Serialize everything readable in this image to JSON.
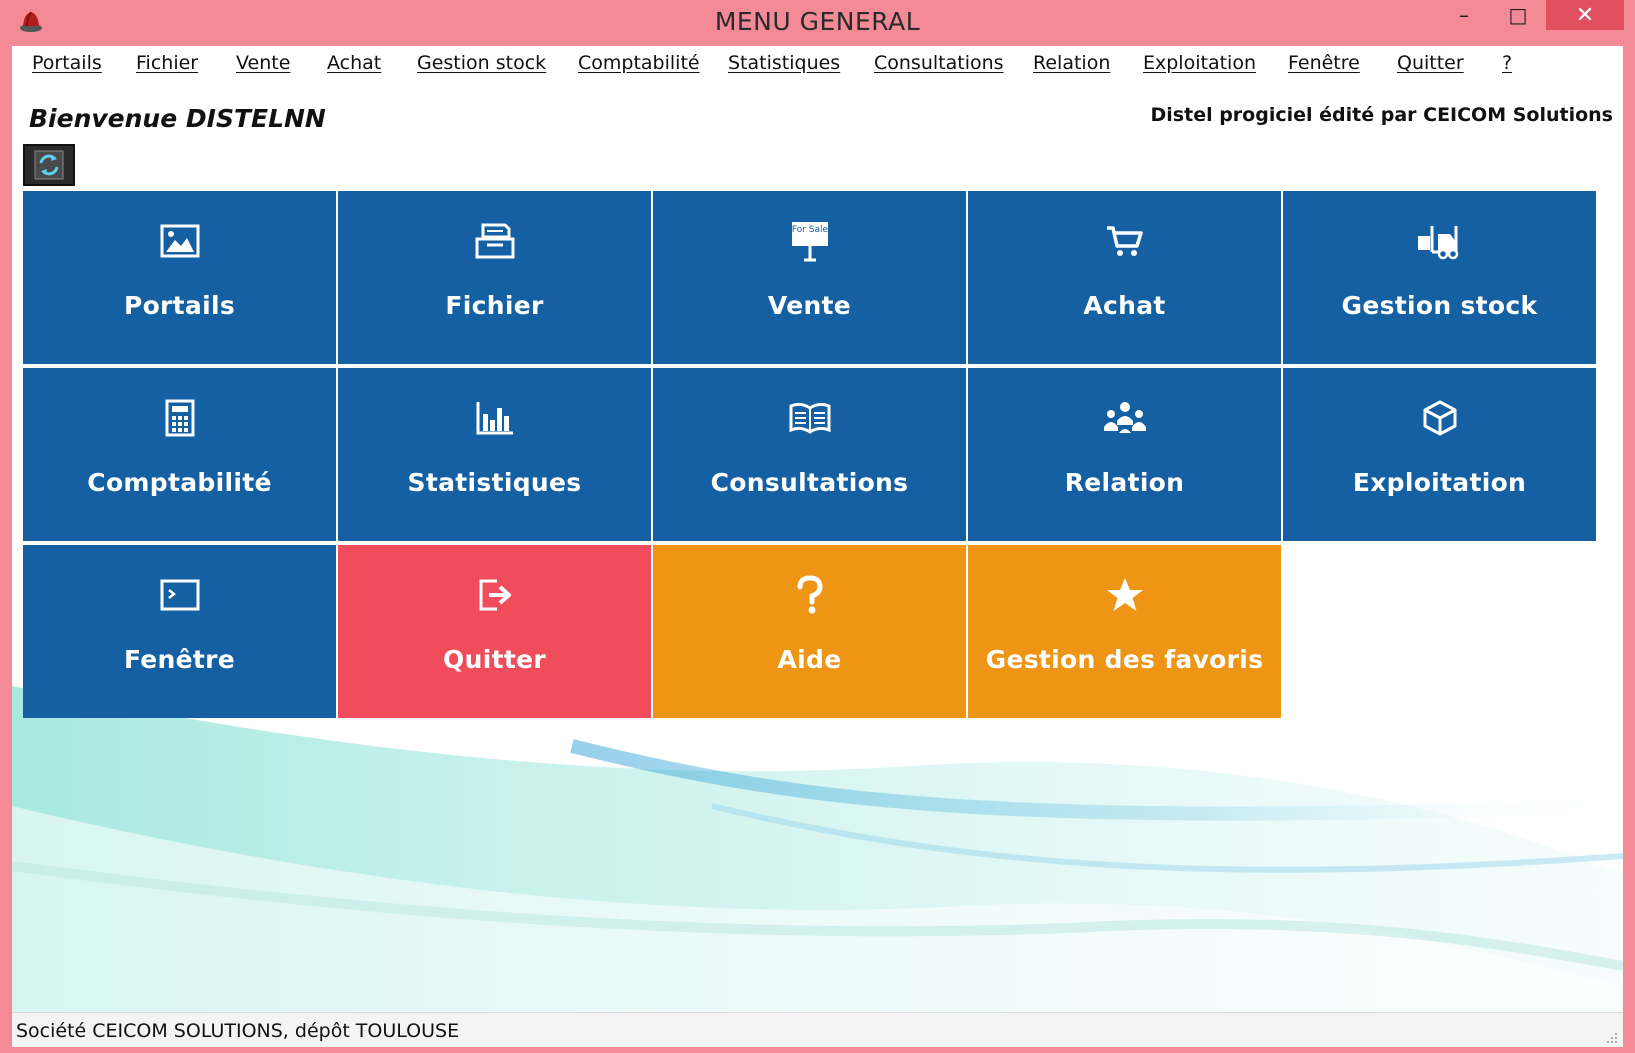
{
  "window": {
    "title": "MENU GENERAL",
    "minimize": "–",
    "maximize": "□",
    "close": "✕"
  },
  "menubar": {
    "items": [
      "Portails",
      "Fichier",
      "Vente",
      "Achat",
      "Gestion stock",
      "Comptabilité",
      "Statistiques",
      "Consultations",
      "Relation",
      "Exploitation",
      "Fenêtre",
      "Quitter",
      "?"
    ]
  },
  "header": {
    "welcome": "Bienvenue DISTELNN",
    "editor": "Distel progiciel édité par CEICOM Solutions"
  },
  "tiles": [
    {
      "label": "Portails",
      "icon": "image-icon",
      "color": "#1460a3"
    },
    {
      "label": "Fichier",
      "icon": "file-tray-icon",
      "color": "#1460a3"
    },
    {
      "label": "Vente",
      "icon": "for-sale-sign-icon",
      "sign_text": "For Sale",
      "color": "#1460a3"
    },
    {
      "label": "Achat",
      "icon": "cart-icon",
      "color": "#1460a3"
    },
    {
      "label": "Gestion stock",
      "icon": "forklift-icon",
      "color": "#1460a3"
    },
    {
      "label": "Comptabilité",
      "icon": "calculator-icon",
      "color": "#1460a3"
    },
    {
      "label": "Statistiques",
      "icon": "bar-chart-icon",
      "color": "#1460a3"
    },
    {
      "label": "Consultations",
      "icon": "open-book-icon",
      "color": "#1460a3"
    },
    {
      "label": "Relation",
      "icon": "people-icon",
      "color": "#1460a3"
    },
    {
      "label": "Exploitation",
      "icon": "cube-icon",
      "color": "#1460a3"
    },
    {
      "label": "Fenêtre",
      "icon": "terminal-window-icon",
      "color": "#1460a3"
    },
    {
      "label": "Quitter",
      "icon": "exit-icon",
      "color": "#f04c5b"
    },
    {
      "label": "Aide",
      "icon": "question-icon",
      "color": "#ef9516"
    },
    {
      "label": "Gestion des favoris",
      "icon": "star-icon",
      "color": "#ef9516"
    }
  ],
  "status": {
    "text": "Société CEICOM SOLUTIONS, dépôt TOULOUSE"
  }
}
